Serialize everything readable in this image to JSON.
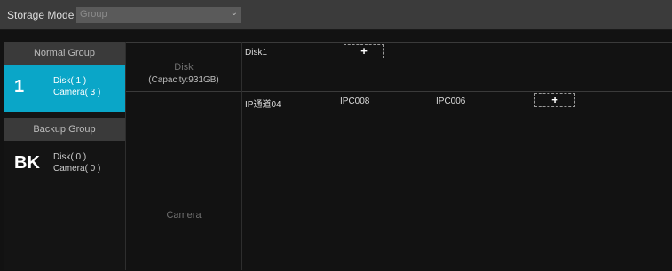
{
  "storage_mode": {
    "label": "Storage Mode",
    "value": "Group"
  },
  "groups": {
    "normal_header": "Normal Group",
    "normal_item": {
      "number": "1",
      "disk": "Disk( 1 )",
      "camera": "Camera( 3 )"
    },
    "backup_header": "Backup Group",
    "backup_item": {
      "number": "BK",
      "disk": "Disk( 0 )",
      "camera": "Camera( 0 )"
    }
  },
  "detail": {
    "disk_label": "Disk",
    "disk_capacity": "(Capacity:931GB)",
    "disks": [
      "Disk1"
    ],
    "add_symbol": "+",
    "camera_label": "Camera",
    "cameras": [
      "IP通道04",
      "IPC008",
      "IPC006"
    ]
  }
}
